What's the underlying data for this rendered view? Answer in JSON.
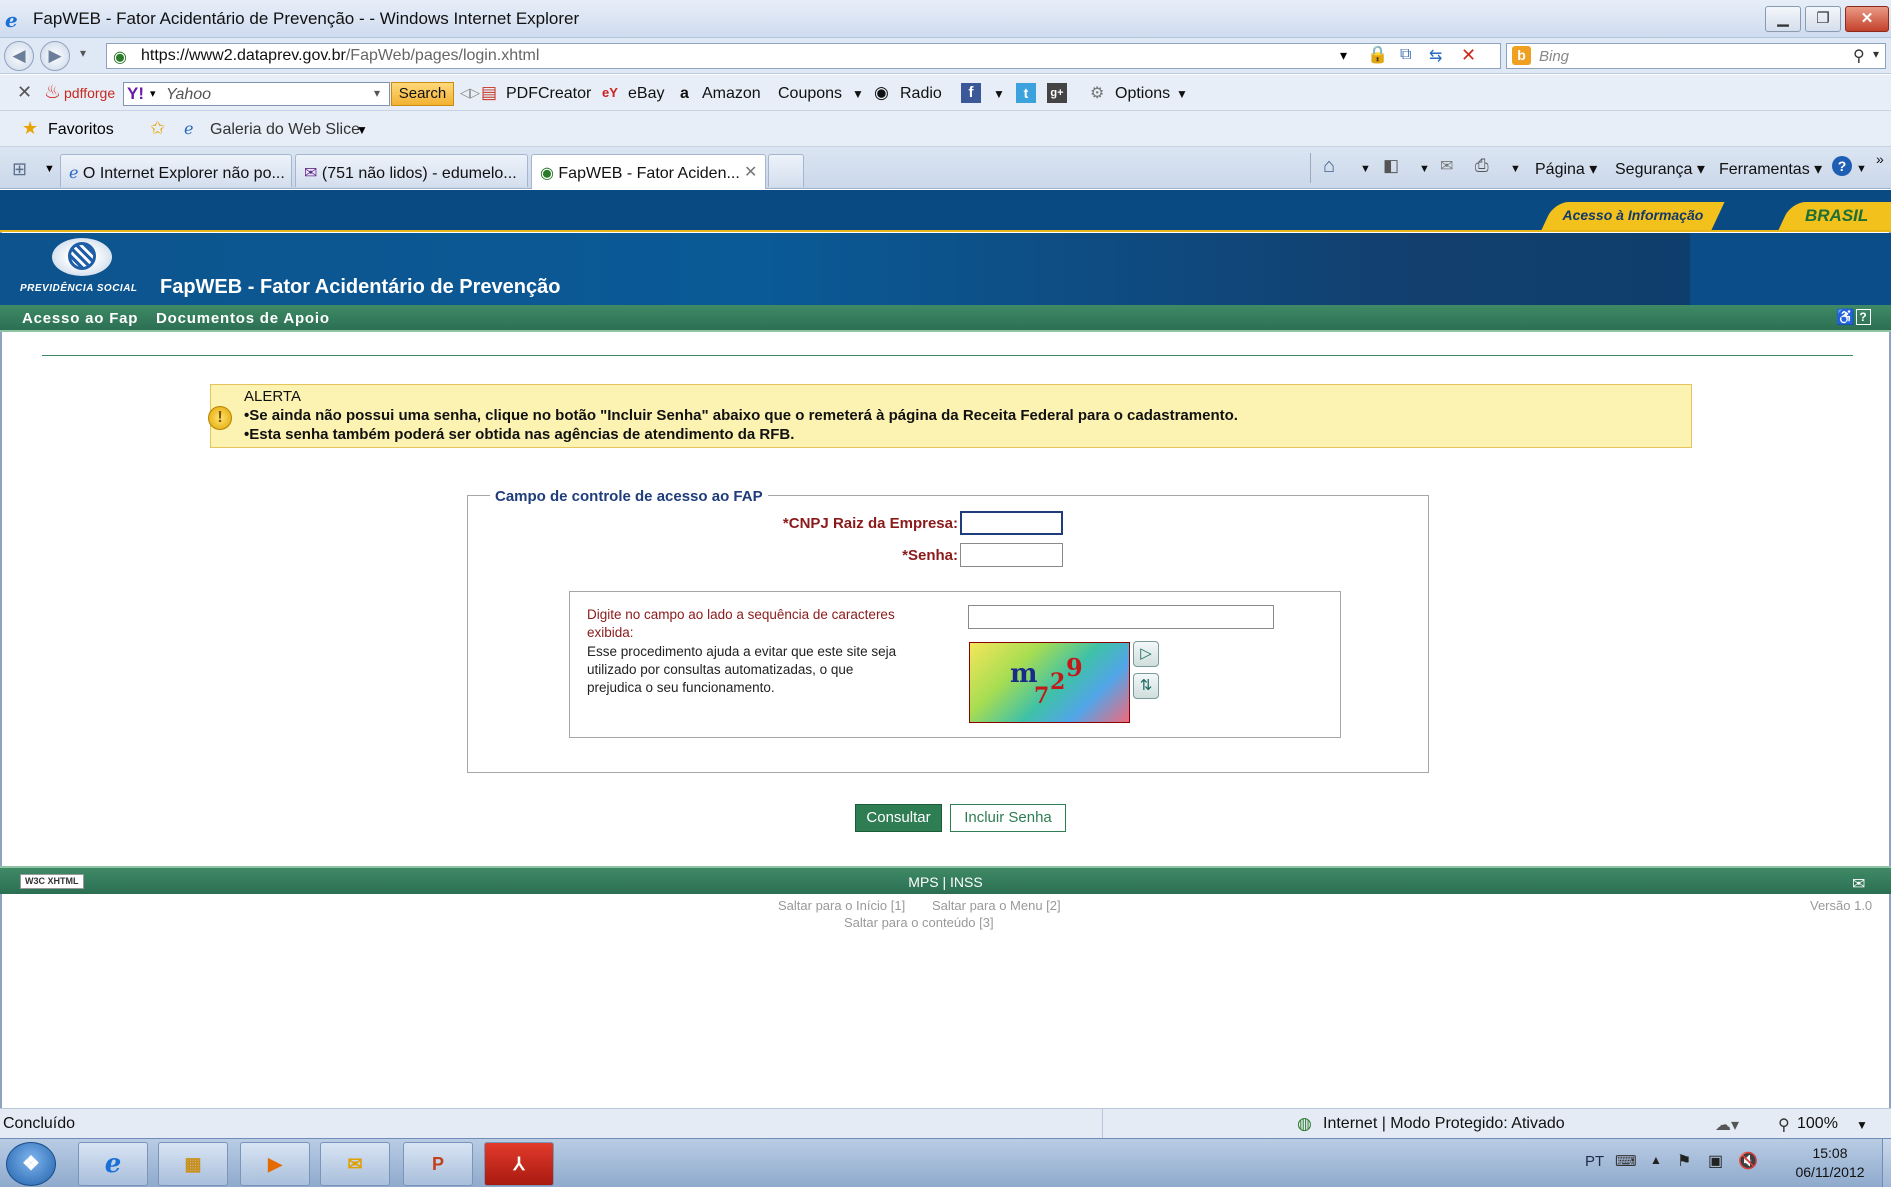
{
  "window": {
    "title": "FapWEB - Fator Acidentário de Prevenção -  - Windows Internet Explorer",
    "min_glyph": "▁",
    "max_glyph": "❐",
    "close_glyph": "✕"
  },
  "address_bar": {
    "url_host": "https://www2.dataprev.gov.br",
    "url_path": "/FapWeb/pages/login.xhtml",
    "search_placeholder": "Bing"
  },
  "toolbar": {
    "pdfforge": "pdfforge",
    "yahoo_placeholder": "Yahoo",
    "search_label": "Search",
    "pdfcreator": "PDFCreator",
    "ebay": "eBay",
    "amazon": "Amazon",
    "coupons": "Coupons",
    "radio": "Radio",
    "options": "Options"
  },
  "favorites_bar": {
    "favorites": "Favoritos",
    "web_slice": "Galeria do Web Slice"
  },
  "tabs": [
    {
      "label": "O Internet Explorer não po..."
    },
    {
      "label": "(751 não lidos) - edumelo..."
    },
    {
      "label": "FapWEB - Fator Aciden..."
    }
  ],
  "command_bar": {
    "page": "Página",
    "security": "Segurança",
    "tools": "Ferramentas"
  },
  "gov_bar": {
    "access_info": "Acesso à Informação",
    "brasil": "BRASIL"
  },
  "header": {
    "logo_text": "PREVIDÊNCIA SOCIAL",
    "app_title": "FapWEB - Fator Acidentário de Prevenção"
  },
  "menu": {
    "item1": "Acesso ao Fap",
    "item2": "Documentos de Apoio"
  },
  "alert": {
    "title": "ALERTA",
    "line1": "•Se ainda não possui uma senha, clique no botão \"Incluir Senha\" abaixo que o remeterá à página da Receita Federal para o cadastramento.",
    "line2": "•Esta senha também poderá ser obtida nas agências de atendimento da RFB."
  },
  "form": {
    "legend": "Campo de controle de acesso ao FAP",
    "cnpj_label": "*CNPJ Raiz da Empresa:",
    "cnpj_value": "",
    "senha_label": "*Senha:",
    "senha_value": "",
    "captcha_instr_1": "Digite no campo ao lado a sequência de caracteres",
    "captcha_instr_2": "exibida:",
    "captcha_help_1": "Esse procedimento ajuda a evitar que este site seja",
    "captcha_help_2": "utilizado por consultas automatizadas, o que",
    "captcha_help_3": "prejudica o seu funcionamento.",
    "captcha_value": "",
    "captcha_chars": [
      "m",
      "7",
      "2",
      "9"
    ],
    "consultar": "Consultar",
    "incluir": "Incluir Senha"
  },
  "footer": {
    "badge": "W3C XHTML",
    "center": "MPS | INSS",
    "skip_start": "Saltar para o Início [1]",
    "skip_menu": "Saltar para o Menu [2]",
    "skip_content": "Saltar para o conteúdo [3]",
    "version": "Versão 1.0"
  },
  "status_bar": {
    "left": "Concluído",
    "zone": "Internet | Modo Protegido: Ativado",
    "zoom": "100%"
  },
  "taskbar": {
    "lang": "PT",
    "time": "15:08",
    "date": "06/11/2012"
  },
  "colors": {
    "gov_blue": "#0a4a82",
    "menu_green": "#2b6f52",
    "alert_bg": "#fcf3b2",
    "label_red": "#8b1a1a"
  }
}
